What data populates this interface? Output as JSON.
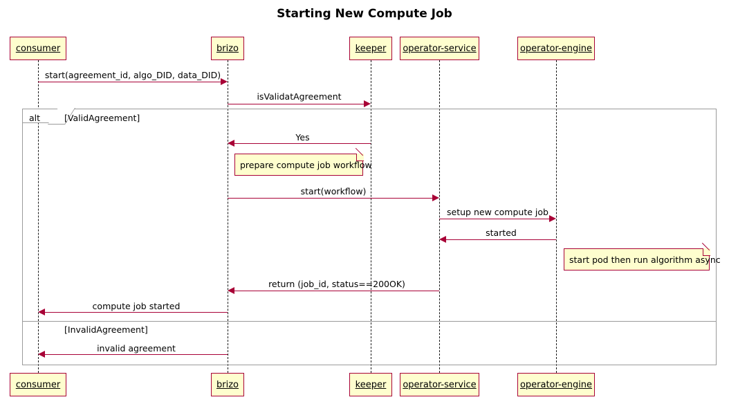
{
  "title": "Starting New Compute Job",
  "colors": {
    "participant_fill": "#FEFECE",
    "participant_border": "#A80036",
    "message": "#A80036",
    "lifeline": "#181818",
    "fragment_border": "#9A9A9A",
    "note_fill": "#FEFECE",
    "note_border": "#A80036",
    "text": "#000000",
    "background": "#FFFFFF"
  },
  "participants": [
    {
      "id": "consumer",
      "label": "consumer"
    },
    {
      "id": "brizo",
      "label": "brizo"
    },
    {
      "id": "keeper",
      "label": "keeper"
    },
    {
      "id": "operator-service",
      "label": "operator-service"
    },
    {
      "id": "operator-engine",
      "label": "operator-engine"
    }
  ],
  "messages": [
    {
      "label": "start(agreement_id, algo_DID, data_DID)",
      "from": "consumer",
      "to": "brizo",
      "direction": "right"
    },
    {
      "label": "isValidatAgreement",
      "from": "brizo",
      "to": "keeper",
      "direction": "right"
    },
    {
      "label": "Yes",
      "from": "keeper",
      "to": "brizo",
      "direction": "left"
    },
    {
      "label": "start(workflow)",
      "from": "brizo",
      "to": "operator-service",
      "direction": "right"
    },
    {
      "label": "setup new compute job",
      "from": "operator-service",
      "to": "operator-engine",
      "direction": "right"
    },
    {
      "label": "started",
      "from": "operator-engine",
      "to": "operator-service",
      "direction": "left"
    },
    {
      "label": "return (job_id, status==200OK)",
      "from": "operator-service",
      "to": "brizo",
      "direction": "left"
    },
    {
      "label": "compute job started",
      "from": "brizo",
      "to": "consumer",
      "direction": "left"
    },
    {
      "label": "invalid agreement",
      "from": "brizo",
      "to": "consumer",
      "direction": "left"
    }
  ],
  "notes": [
    {
      "text": "prepare compute job workflow",
      "over": "brizo"
    },
    {
      "text": "start pod then run algorithm async",
      "over": "operator-engine"
    }
  ],
  "fragment": {
    "operator": "alt",
    "guards": [
      {
        "label": "[ValidAgreement]"
      },
      {
        "label": "[InvalidAgreement]"
      }
    ]
  }
}
